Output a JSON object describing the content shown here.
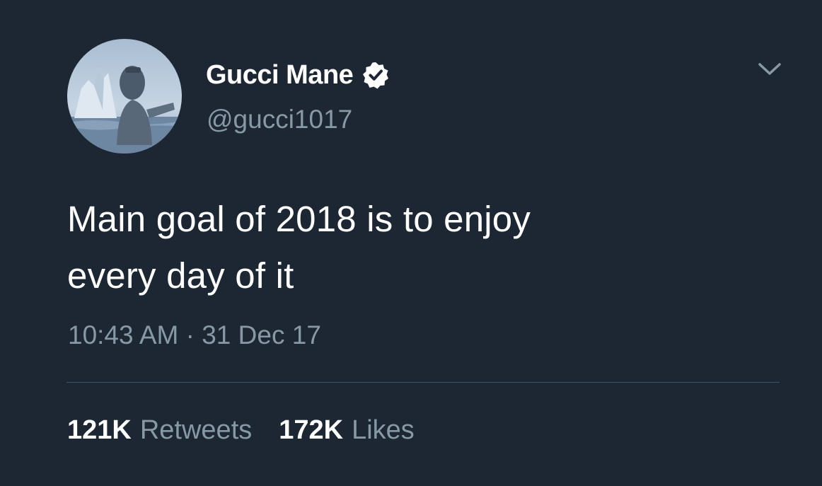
{
  "user": {
    "display_name": "Gucci Mane",
    "handle": "@gucci1017",
    "verified": true,
    "verified_icon": "verified-badge-icon",
    "avatar": "profile-avatar"
  },
  "tweet": {
    "text_lines": [
      "Main goal of 2018 is to enjoy",
      "every day of it"
    ],
    "time": "10:43 AM",
    "separator": "·",
    "date": "31 Dec 17"
  },
  "stats": {
    "retweets_count": "121K",
    "retweets_label": "Retweets",
    "likes_count": "172K",
    "likes_label": "Likes"
  },
  "menu": {
    "icon": "chevron-down-icon"
  },
  "colors": {
    "background": "#1c2733",
    "text_primary": "#ffffff",
    "text_secondary": "#8899a6",
    "divider": "#3d5466"
  }
}
